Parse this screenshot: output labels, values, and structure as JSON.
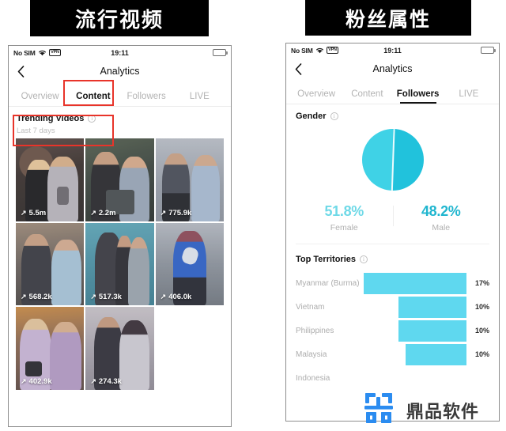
{
  "banners": {
    "left": "流行视频",
    "right": "粉丝属性"
  },
  "left_phone": {
    "status_bar": {
      "carrier": "No SIM",
      "wifi_icon": "wifi-icon",
      "vpn_badge": "VPN",
      "time": "19:11",
      "battery_icon": "battery-icon"
    },
    "nav": {
      "back_icon": "back-chevron-icon",
      "title": "Analytics"
    },
    "tabs": [
      {
        "label": "Overview",
        "active": false
      },
      {
        "label": "Content",
        "active": true
      },
      {
        "label": "Followers",
        "active": false
      },
      {
        "label": "LIVE",
        "active": false
      }
    ],
    "trending": {
      "title": "Trending Videos",
      "info_icon": "info-icon",
      "subtitle": "Last 7 days",
      "videos": [
        {
          "views": "5.5m",
          "icon": "arrow-up-right-icon"
        },
        {
          "views": "2.2m",
          "icon": "arrow-up-right-icon"
        },
        {
          "views": "775.9k",
          "icon": "arrow-up-right-icon"
        },
        {
          "views": "568.2k",
          "icon": "arrow-up-right-icon"
        },
        {
          "views": "517.3k",
          "icon": "arrow-up-right-icon"
        },
        {
          "views": "406.0k",
          "icon": "arrow-up-right-icon"
        },
        {
          "views": "402.9k",
          "icon": "arrow-up-right-icon"
        },
        {
          "views": "274.3k",
          "icon": "arrow-up-right-icon"
        }
      ]
    }
  },
  "right_phone": {
    "status_bar": {
      "carrier": "No SIM",
      "wifi_icon": "wifi-icon",
      "vpn_badge": "VPN",
      "time": "19:11",
      "battery_icon": "battery-icon"
    },
    "nav": {
      "back_icon": "back-chevron-icon",
      "title": "Analytics"
    },
    "tabs": [
      {
        "label": "Overview",
        "active": false
      },
      {
        "label": "Content",
        "active": false
      },
      {
        "label": "Followers",
        "active": true
      },
      {
        "label": "LIVE",
        "active": false
      }
    ],
    "gender": {
      "title": "Gender",
      "info_icon": "info-icon",
      "female_pct": "51.8%",
      "female_label": "Female",
      "male_pct": "48.2%",
      "male_label": "Male"
    },
    "territories": {
      "title": "Top Territories",
      "info_icon": "info-icon",
      "rows": [
        {
          "name": "Myanmar (Burma)",
          "pct": "17%"
        },
        {
          "name": "Vietnam",
          "pct": "10%"
        },
        {
          "name": "Philippines",
          "pct": "10%"
        },
        {
          "name": "Malaysia",
          "pct": "10%"
        },
        {
          "name": "Indonesia",
          "pct": ""
        }
      ]
    }
  },
  "watermark": {
    "logo_icon": "dingpin-logo-icon",
    "text": "鼎品软件"
  },
  "colors": {
    "accent_cyan": "#5fd8ef",
    "pie_female": "#3fd2e6",
    "pie_male": "#21c2dc",
    "female_text": "#6fd9e7",
    "male_text": "#21b6cf",
    "annotation_red": "#e8342a",
    "logo_blue": "#2b8cf0"
  },
  "chart_data": [
    {
      "type": "pie",
      "title": "Gender",
      "labels": [
        "Female",
        "Male"
      ],
      "values": [
        51.8,
        48.2
      ],
      "colors": [
        "#3fd2e6",
        "#21c2dc"
      ],
      "legend": "below"
    },
    {
      "type": "bar",
      "title": "Top Territories",
      "orientation": "horizontal",
      "categories": [
        "Myanmar (Burma)",
        "Vietnam",
        "Philippines",
        "Malaysia",
        "Indonesia"
      ],
      "values": [
        17,
        10,
        10,
        10,
        null
      ],
      "value_labels": [
        "17%",
        "10%",
        "10%",
        "10%",
        ""
      ],
      "xlabel": "",
      "ylabel": "",
      "xlim": [
        0,
        17
      ],
      "grid": false,
      "bar_color": "#5fd8ef",
      "note": "bars are right-aligned; Indonesia row is cut off at bottom of viewport"
    }
  ]
}
